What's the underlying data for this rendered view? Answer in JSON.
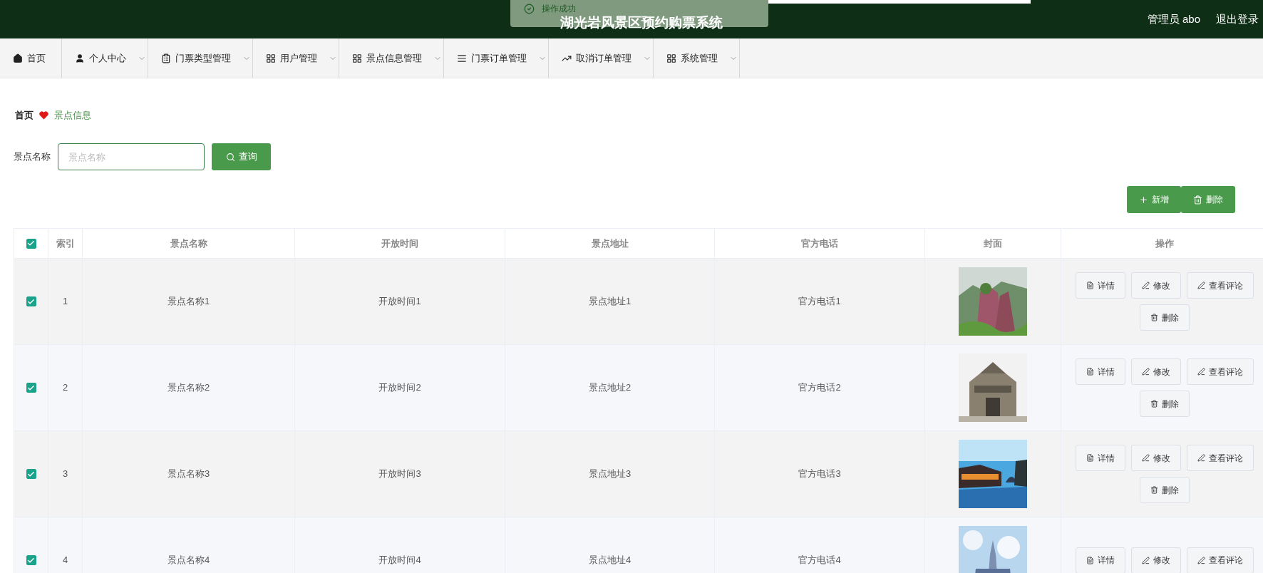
{
  "header": {
    "title": "湖光岩风景区预约购票系统",
    "user": "管理员 abo",
    "logout": "退出登录"
  },
  "toast": {
    "message": "操作成功"
  },
  "nav": [
    {
      "label": "首页",
      "dropdown": false
    },
    {
      "label": "个人中心",
      "dropdown": true
    },
    {
      "label": "门票类型管理",
      "dropdown": true
    },
    {
      "label": "用户管理",
      "dropdown": true
    },
    {
      "label": "景点信息管理",
      "dropdown": true
    },
    {
      "label": "门票订单管理",
      "dropdown": true
    },
    {
      "label": "取消订单管理",
      "dropdown": true
    },
    {
      "label": "系统管理",
      "dropdown": true
    }
  ],
  "breadcrumb": [
    "首页",
    "景点信息"
  ],
  "search": {
    "label": "景点名称",
    "placeholder": "景点名称",
    "button": "查询"
  },
  "actions": [
    "新增",
    "删除"
  ],
  "table": {
    "all_checked": true,
    "columns": [
      "索引",
      "景点名称",
      "开放时间",
      "景点地址",
      "官方电话",
      "封面",
      "操作"
    ],
    "rows": [
      {
        "checked": true,
        "index": "1",
        "name": "景点名称1",
        "time": "开放时间1",
        "address": "景点地址1",
        "phone": "官方电话1",
        "cover": {
          "kind": "picture"
        },
        "buttons": [
          "详情",
          "修改",
          "查看评论",
          "删除"
        ]
      },
      {
        "checked": true,
        "index": "2",
        "name": "景点名称2",
        "time": "开放时间2",
        "address": "景点地址2",
        "phone": "官方电话2",
        "cover": {
          "kind": "picture"
        },
        "buttons": [
          "详情",
          "修改",
          "查看评论",
          "删除"
        ]
      },
      {
        "checked": true,
        "index": "3",
        "name": "景点名称3",
        "time": "开放时间3",
        "address": "景点地址3",
        "phone": "官方电话3",
        "cover": {
          "kind": "picture"
        },
        "buttons": [
          "详情",
          "修改",
          "查看评论",
          "删除"
        ]
      },
      {
        "checked": true,
        "index": "4",
        "name": "景点名称4",
        "time": "开放时间4",
        "address": "景点地址4",
        "phone": "官方电话4",
        "cover": {
          "kind": "picture"
        },
        "buttons": [
          "详情",
          "修改",
          "查看评论"
        ]
      }
    ]
  }
}
